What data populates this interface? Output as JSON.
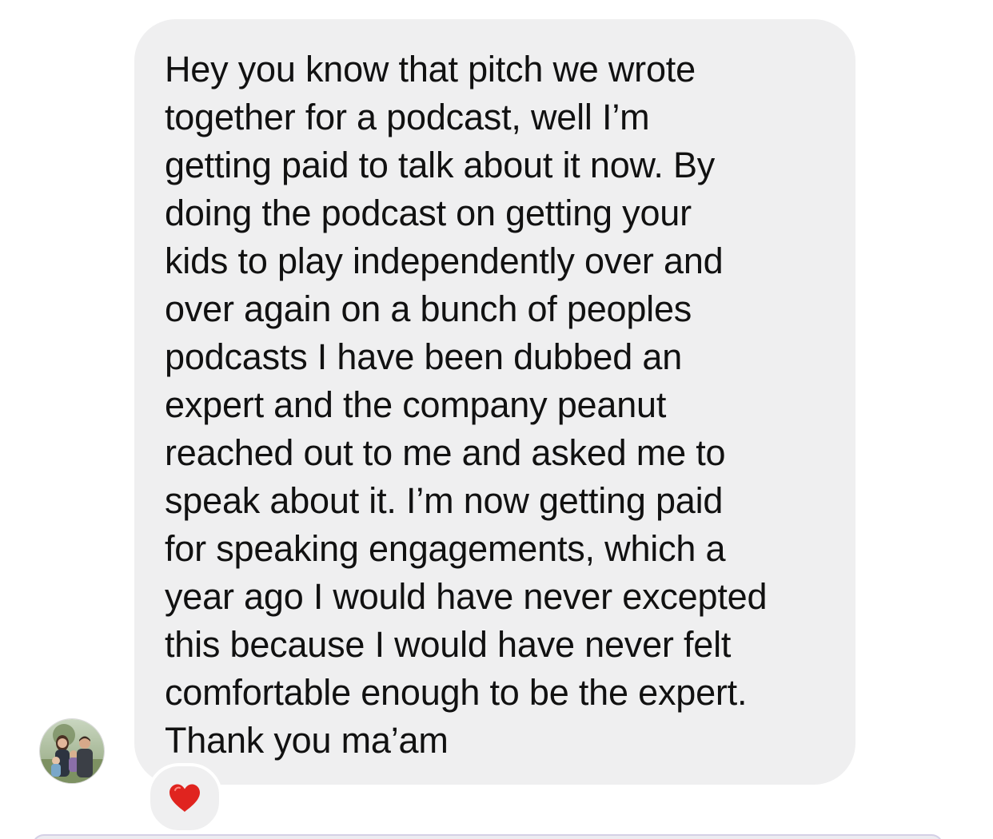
{
  "message": {
    "sender": "received",
    "lines": [
      "Hey you know that pitch we wrote",
      "together for a podcast, well I’m",
      "getting paid to talk about it now. By",
      "doing the podcast on getting your",
      "kids to play independently over and",
      "over again on a bunch of peoples",
      "podcasts I have been dubbed an",
      "expert and the company peanut",
      "reached out to me and asked me to",
      "speak about it. I’m now getting paid",
      "for speaking engagements, which a",
      "year ago I would have never excepted",
      "this because I would have never felt",
      "comfortable enough to be the expert.",
      "Thank you ma’am"
    ],
    "bubble_color": "#efeff0",
    "text_color": "#111111"
  },
  "avatar": {
    "icon": "family-photo-avatar"
  },
  "reaction": {
    "icon": "red-heart-icon",
    "color": "#e0241f"
  }
}
